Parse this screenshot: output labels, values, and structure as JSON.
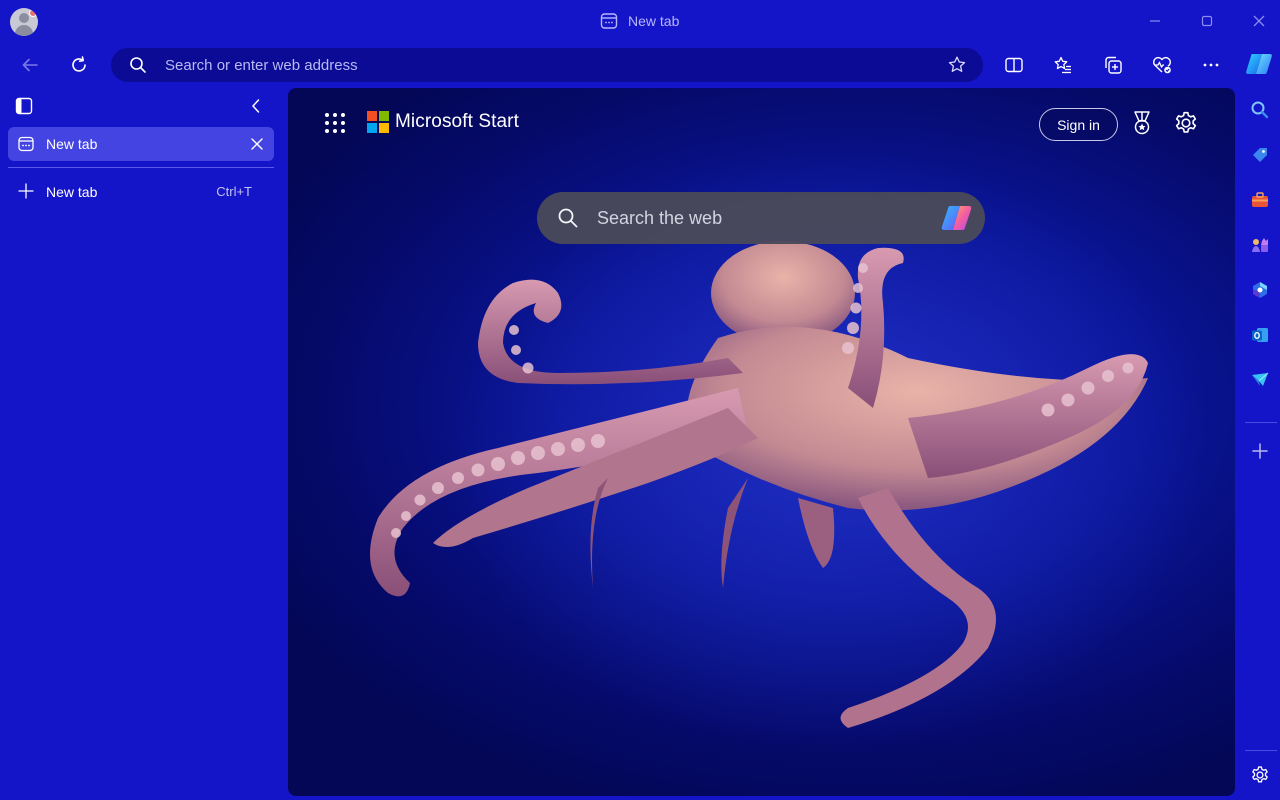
{
  "window": {
    "title": "New tab"
  },
  "toolbar": {
    "address_placeholder": "Search or enter web address"
  },
  "vertical_tabs": {
    "tabs": [
      {
        "label": "New tab",
        "active": true
      }
    ],
    "new_tab": {
      "label": "New tab",
      "shortcut": "Ctrl+T"
    }
  },
  "newtab_page": {
    "brand": "Microsoft Start",
    "sign_in_label": "Sign in",
    "search_placeholder": "Search the web",
    "ms_logo_colors": [
      "#f25022",
      "#7fba00",
      "#00a4ef",
      "#ffb900"
    ]
  },
  "right_sidebar": {
    "icons": [
      "search-icon",
      "shopping-tag-icon",
      "tools-icon",
      "games-icon",
      "microsoft-365-icon",
      "outlook-icon",
      "drop-icon",
      "add-icon",
      "sidebar-settings-icon"
    ]
  },
  "colors": {
    "theme_background": "#1414c8",
    "active_tab": "#4444e2",
    "address_bar": "#0b0b96"
  }
}
